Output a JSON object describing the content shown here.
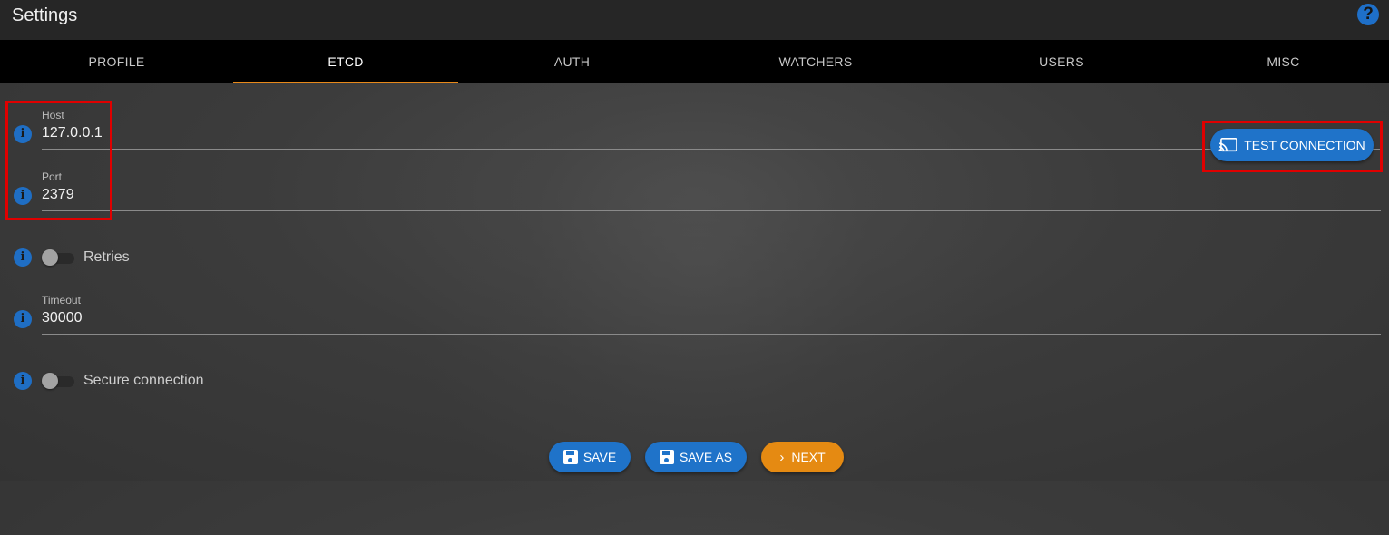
{
  "header": {
    "title": "Settings",
    "help_icon": "question-circle-icon"
  },
  "tabs": [
    {
      "label": "PROFILE"
    },
    {
      "label": "ETCD",
      "active": true
    },
    {
      "label": "AUTH"
    },
    {
      "label": "WATCHERS"
    },
    {
      "label": "USERS"
    },
    {
      "label": "MISC"
    }
  ],
  "form": {
    "host": {
      "label": "Host",
      "value": "127.0.0.1"
    },
    "port": {
      "label": "Port",
      "value": "2379"
    },
    "retries": {
      "label": "Retries",
      "enabled": false
    },
    "timeout": {
      "label": "Timeout",
      "value": "30000"
    },
    "secure": {
      "label": "Secure connection",
      "enabled": false
    },
    "info_icon": "i"
  },
  "actions": {
    "test_connection": "TEST CONNECTION",
    "save": "SAVE",
    "save_as": "SAVE AS",
    "next": "NEXT"
  },
  "colors": {
    "accent_blue": "#1f73c9",
    "accent_orange": "#e58a12",
    "highlight_red": "#e00000",
    "tab_indicator": "#e8891a"
  }
}
